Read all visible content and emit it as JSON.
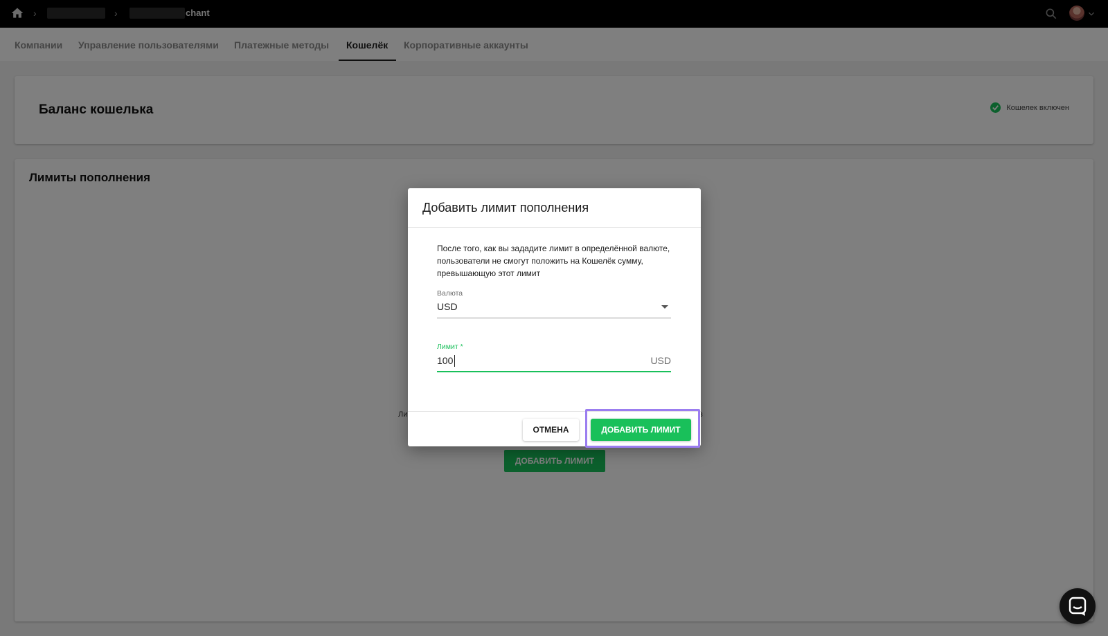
{
  "breadcrumb": {
    "last": "chant"
  },
  "tabs": [
    {
      "label": "Компании"
    },
    {
      "label": "Управление пользователями"
    },
    {
      "label": "Платежные методы"
    },
    {
      "label": "Кошелёк"
    },
    {
      "label": "Корпоративные аккаунты"
    }
  ],
  "balance_card": {
    "title": "Баланс кошелька",
    "status": "Кошелек включен"
  },
  "limits_card": {
    "title": "Лимиты пополнения",
    "empty_left": "Ли",
    "empty_right": "в",
    "add_button": "ДОБАВИТЬ ЛИМИТ"
  },
  "dialog": {
    "title": "Добавить лимит пополнения",
    "description": "После того, как вы зададите лимит в определённой валюте, пользователи не смогут положить на Кошелёк сумму, превышающую этот лимит",
    "currency_label": "Валюта",
    "currency_value": "USD",
    "limit_label": "Лимит *",
    "limit_value": "100",
    "limit_suffix": "USD",
    "cancel_label": "ОТМЕНА",
    "confirm_label": "ДОБАВИТЬ ЛИМИТ"
  },
  "colors": {
    "accent": "#19c05a",
    "highlight": "#9b7df0",
    "topbar": "#000000"
  }
}
